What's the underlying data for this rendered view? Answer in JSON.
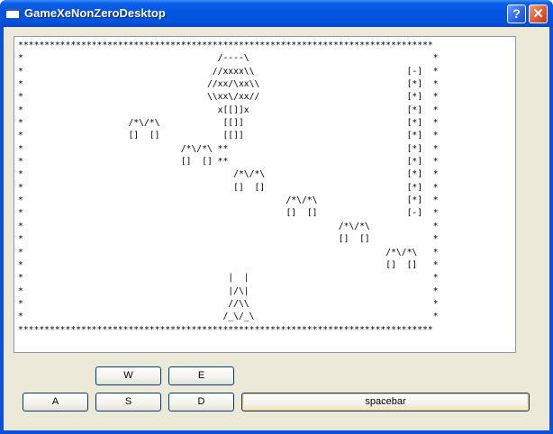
{
  "window": {
    "title": "GameXeNonZeroDesktop",
    "help_label": "?",
    "close_label": "✕"
  },
  "game": {
    "board_rows": [
      "*******************************************************************************",
      "*                                     /----\\                                   *",
      "*                                    //xxxx\\\\                             [-]  *",
      "*                                   //xx/\\xx\\\\                            [*]  *",
      "*                                   \\\\xx\\/xx//                            [*]  *",
      "*                                     x[[]]x                              [*]  *",
      "*                    /*\\/*\\            [[]]                               [*]  *",
      "*                    []  []            [[]]                               [*]  *",
      "*                              /*\\/*\\ **                                  [*]  *",
      "*                              []  [] **                                  [*]  *",
      "*                                        /*\\/*\\                           [*]  *",
      "*                                        []  []                           [*]  *",
      "*                                                  /*\\/*\\                 [*]  *",
      "*                                                  []  []                 [-]  *",
      "*                                                            /*\\/*\\            *",
      "*                                                            []  []            *",
      "*                                                                     /*\\/*\\   *",
      "*                                                                     []  []   *",
      "*                                       |  |                                   *",
      "*                                       |/\\|                                   *",
      "*                                       //\\\\                                   *",
      "*                                      /_\\/_\\                                  *",
      "*******************************************************************************"
    ]
  },
  "controls": {
    "w": "W",
    "e": "E",
    "a": "A",
    "s": "S",
    "d": "D",
    "space": "spacebar"
  }
}
